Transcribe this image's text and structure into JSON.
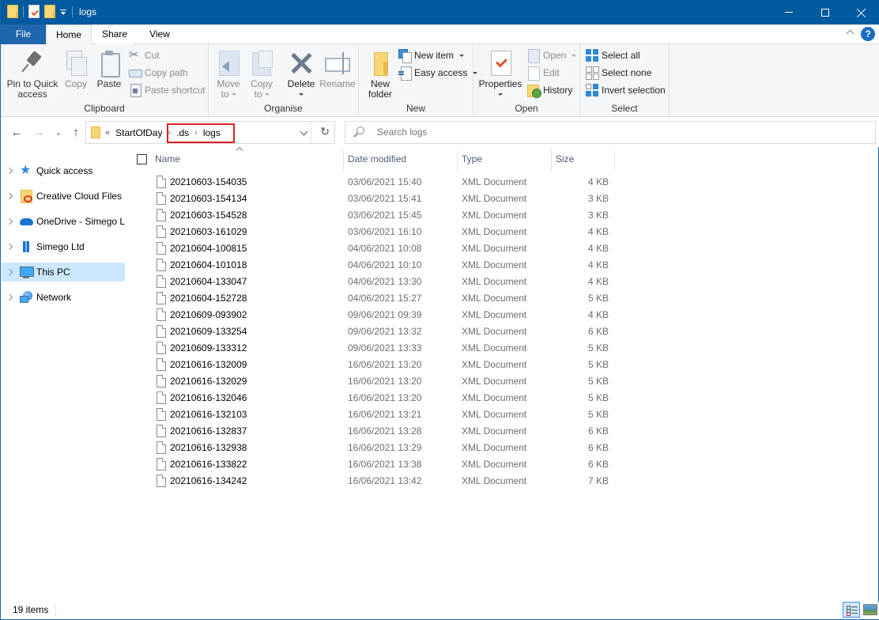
{
  "window": {
    "title": "logs",
    "controls": {
      "minimize": "minimize",
      "maximize": "maximize",
      "close": "close"
    }
  },
  "ribbon": {
    "tabs": [
      {
        "label": "File"
      },
      {
        "label": "Home",
        "active": true
      },
      {
        "label": "Share"
      },
      {
        "label": "View"
      }
    ],
    "help": "?",
    "groups": {
      "clipboard": {
        "label": "Clipboard",
        "pin": "Pin to Quick access",
        "pin_line1": "Pin to Quick",
        "pin_line2": "access",
        "copy": "Copy",
        "paste": "Paste",
        "cut": "Cut",
        "copy_path": "Copy path",
        "paste_shortcut": "Paste shortcut"
      },
      "organise": {
        "label": "Organise",
        "move_to_line1": "Move",
        "move_to_line2": "to",
        "copy_to_line1": "Copy",
        "copy_to_line2": "to",
        "delete": "Delete",
        "rename": "Rename"
      },
      "new": {
        "label": "New",
        "new_folder_line1": "New",
        "new_folder_line2": "folder",
        "new_item": "New item",
        "easy_access": "Easy access"
      },
      "open": {
        "label": "Open",
        "properties": "Properties",
        "open": "Open",
        "edit": "Edit",
        "history": "History"
      },
      "select": {
        "label": "Select",
        "select_all": "Select all",
        "select_none": "Select none",
        "invert_selection": "Invert selection"
      }
    }
  },
  "navigation": {
    "back": "←",
    "forward": "→",
    "recent": "⌄",
    "up": "↑",
    "refresh": "↻",
    "breadcrumb": {
      "overflow": "«",
      "parts": [
        "StartOfDay",
        ".ds",
        "logs"
      ],
      "separator": "›"
    },
    "search_placeholder": "Search logs"
  },
  "nav_pane": {
    "items": [
      {
        "label": "Quick access",
        "icon": "star-icon"
      },
      {
        "label": "Creative Cloud Files",
        "icon": "creative-cloud-folder-icon"
      },
      {
        "label": "OneDrive - Simego Ltd",
        "icon": "onedrive-cloud-icon"
      },
      {
        "label": "Simego Ltd",
        "icon": "building-icon"
      },
      {
        "label": "This PC",
        "icon": "computer-icon",
        "selected": true
      },
      {
        "label": "Network",
        "icon": "network-icon"
      }
    ]
  },
  "file_list": {
    "columns": {
      "name": "Name",
      "date": "Date modified",
      "type": "Type",
      "size": "Size"
    },
    "sort": {
      "column": "name",
      "direction": "ascending"
    },
    "files": [
      {
        "name": "20210603-154035",
        "date": "03/06/2021 15:40",
        "type": "XML Document",
        "size": "4 KB"
      },
      {
        "name": "20210603-154134",
        "date": "03/06/2021 15:41",
        "type": "XML Document",
        "size": "3 KB"
      },
      {
        "name": "20210603-154528",
        "date": "03/06/2021 15:45",
        "type": "XML Document",
        "size": "3 KB"
      },
      {
        "name": "20210603-161029",
        "date": "03/06/2021 16:10",
        "type": "XML Document",
        "size": "4 KB"
      },
      {
        "name": "20210604-100815",
        "date": "04/06/2021 10:08",
        "type": "XML Document",
        "size": "4 KB"
      },
      {
        "name": "20210604-101018",
        "date": "04/06/2021 10:10",
        "type": "XML Document",
        "size": "4 KB"
      },
      {
        "name": "20210604-133047",
        "date": "04/06/2021 13:30",
        "type": "XML Document",
        "size": "4 KB"
      },
      {
        "name": "20210604-152728",
        "date": "04/06/2021 15:27",
        "type": "XML Document",
        "size": "5 KB"
      },
      {
        "name": "20210609-093902",
        "date": "09/06/2021 09:39",
        "type": "XML Document",
        "size": "4 KB"
      },
      {
        "name": "20210609-133254",
        "date": "09/06/2021 13:32",
        "type": "XML Document",
        "size": "6 KB"
      },
      {
        "name": "20210609-133312",
        "date": "09/06/2021 13:33",
        "type": "XML Document",
        "size": "5 KB"
      },
      {
        "name": "20210616-132009",
        "date": "16/06/2021 13:20",
        "type": "XML Document",
        "size": "5 KB"
      },
      {
        "name": "20210616-132029",
        "date": "16/06/2021 13:20",
        "type": "XML Document",
        "size": "5 KB"
      },
      {
        "name": "20210616-132046",
        "date": "16/06/2021 13:20",
        "type": "XML Document",
        "size": "5 KB"
      },
      {
        "name": "20210616-132103",
        "date": "16/06/2021 13:21",
        "type": "XML Document",
        "size": "5 KB"
      },
      {
        "name": "20210616-132837",
        "date": "16/06/2021 13:28",
        "type": "XML Document",
        "size": "6 KB"
      },
      {
        "name": "20210616-132938",
        "date": "16/06/2021 13:29",
        "type": "XML Document",
        "size": "6 KB"
      },
      {
        "name": "20210616-133822",
        "date": "16/06/2021 13:38",
        "type": "XML Document",
        "size": "6 KB"
      },
      {
        "name": "20210616-134242",
        "date": "16/06/2021 13:42",
        "type": "XML Document",
        "size": "7 KB"
      }
    ]
  },
  "status_bar": {
    "item_count": "19 items",
    "views": [
      "details-view",
      "large-icons-view"
    ],
    "active_view": "details-view"
  },
  "colors": {
    "titlebar": "#005a9e",
    "selection": "#cce8ff",
    "highlight_box": "#e01f26"
  }
}
